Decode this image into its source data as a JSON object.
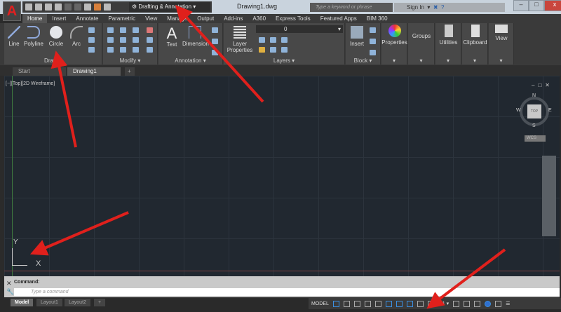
{
  "app": {
    "logo": "A",
    "document_title": "Drawing1.dwg",
    "workspace": "Drafting & Annotation",
    "search_placeholder": "Type a keyword or phrase",
    "sign_in": "Sign In"
  },
  "window_buttons": [
    "–",
    "□",
    "x"
  ],
  "ribbon_tabs": [
    "Home",
    "Insert",
    "Annotate",
    "Parametric",
    "View",
    "Manage",
    "Output",
    "Add-ins",
    "A360",
    "Express Tools",
    "Featured Apps",
    "BIM 360"
  ],
  "panels": {
    "draw": {
      "label": "Draw ▾",
      "buttons": [
        "Line",
        "Polyline",
        "Circle",
        "Arc"
      ]
    },
    "modify": {
      "label": "Modify ▾"
    },
    "annotation": {
      "label": "Annotation ▾",
      "buttons": [
        "Text",
        "Dimension"
      ]
    },
    "layers": {
      "label": "Layers ▾",
      "button": "Layer Properties",
      "layer_value": "0"
    },
    "block": {
      "label": "Block ▾",
      "button": "Insert"
    },
    "collapsed": [
      "Properties",
      "Groups",
      "Utilities",
      "Clipboard",
      "View"
    ]
  },
  "file_tabs": [
    "Start",
    "Drawing1",
    "+"
  ],
  "viewport": {
    "label": "[−][Top][2D Wireframe]",
    "compass": {
      "n": "N",
      "s": "S",
      "e": "E",
      "w": "W",
      "cube": "TOP"
    },
    "ucs": "WCS",
    "axis_x": "X",
    "axis_y": "Y",
    "controls": [
      "–",
      "□",
      "✕"
    ]
  },
  "command": {
    "label": "Command:",
    "placeholder": "Type a command"
  },
  "layout_tabs": [
    "Model",
    "Layout1",
    "Layout2",
    "+"
  ],
  "status": {
    "model": "MODEL",
    "scale": "1:1 ▾"
  }
}
